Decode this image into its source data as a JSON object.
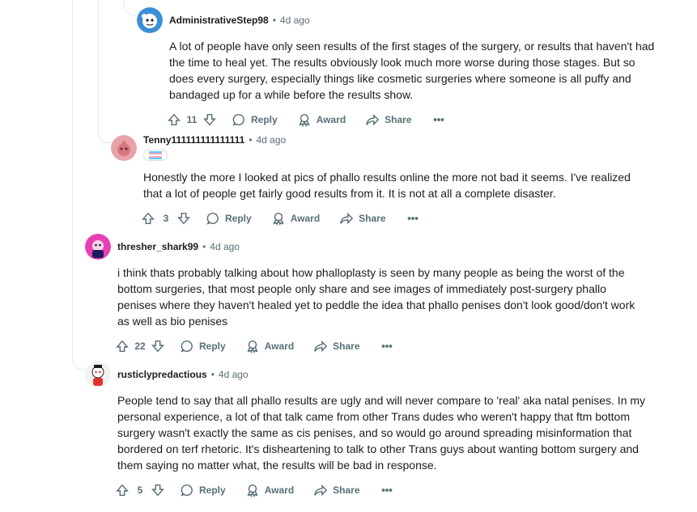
{
  "comments": [
    {
      "author": "AdministrativeStep98",
      "time": "4d ago",
      "body": "A lot of people have only seen results of the first stages of the surgery, or results that haven't had the time to heal yet. The results obviously look much more worse during those stages. But so does every surgery, especially things like cosmetic surgeries where someone is all puffy and bandaged up for a while before the results show.",
      "votes": "11",
      "reply": "Reply",
      "award": "Award",
      "share": "Share"
    },
    {
      "author": "Tenny111111111111111",
      "time": "4d ago",
      "body": "Honestly the more I looked at pics of phallo results online the more not bad it seems. I've realized that a lot of people get fairly good results from it. It is not at all a complete disaster.",
      "votes": "3",
      "reply": "Reply",
      "award": "Award",
      "share": "Share"
    },
    {
      "author": "thresher_shark99",
      "time": "4d ago",
      "body": "i think thats probably talking about how phalloplasty is seen by many people as being the worst of the bottom surgeries, that most people only share and see images of immediately post-surgery phallo penises where they haven't healed yet to peddle the idea that phallo penises don't look good/don't work as well as bio penises",
      "votes": "22",
      "reply": "Reply",
      "award": "Award",
      "share": "Share"
    },
    {
      "author": "rusticlypredactious",
      "time": "4d ago",
      "body": "People tend to say that all phallo results are ugly and will never compare to 'real' aka natal penises. In my personal experience, a lot of that talk came from other Trans dudes who weren't happy that ftm bottom surgery wasn't exactly the same as cis penises, and so would go around spreading misinformation that bordered on terf rhetoric. It's disheartening to talk to other Trans guys about wanting bottom surgery and them saying no matter what, the results will be bad in response.",
      "votes": "5",
      "reply": "Reply",
      "award": "Award",
      "share": "Share"
    }
  ],
  "separator": "•",
  "colors": {
    "meta": "#576f76",
    "thread": "#e5ebee",
    "text": "#1c1c1c"
  }
}
